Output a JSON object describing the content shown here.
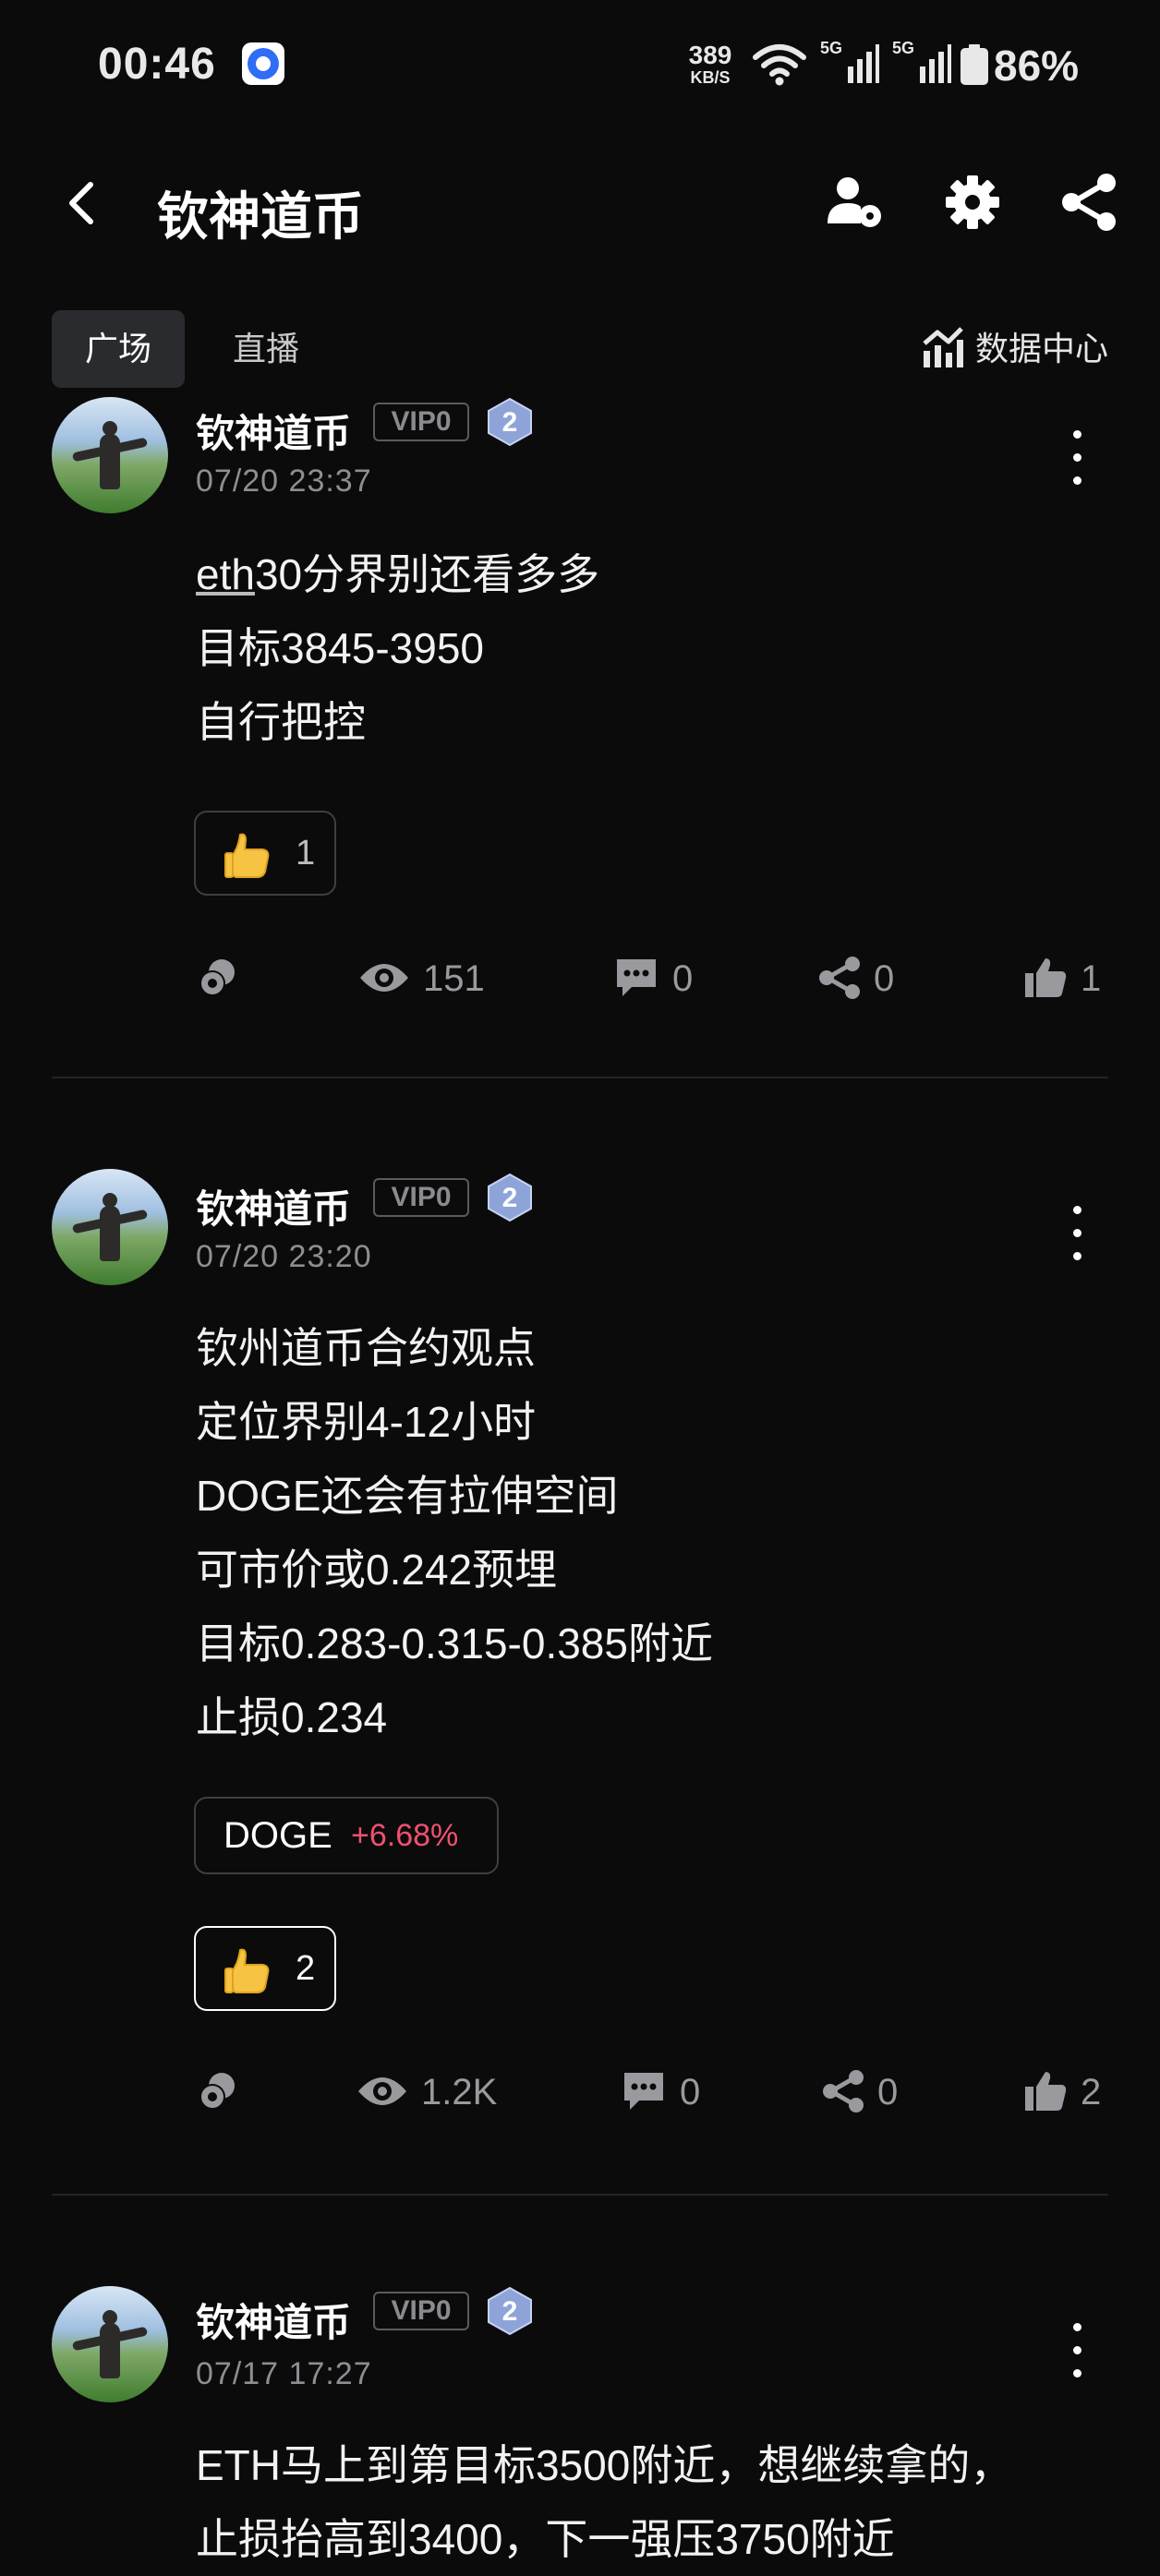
{
  "status_bar": {
    "time": "00:46",
    "net_speed_value": "389",
    "net_speed_unit": "KB/S",
    "signal1_label": "5G",
    "signal2_label": "5G",
    "battery": "86%"
  },
  "header": {
    "title": "钦神道币"
  },
  "tabs": {
    "square": "广场",
    "live": "直播",
    "data_center": "数据中心"
  },
  "posts": [
    {
      "author": "钦神道币",
      "vip": "VIP0",
      "level": "2",
      "time": "07/20 23:37",
      "lines": [
        "eth",
        "30分界别还看多多",
        "目标3845-3950",
        "自行把控"
      ],
      "reaction_count": "1",
      "views": "151",
      "comments": "0",
      "shares": "0",
      "likes": "1"
    },
    {
      "author": "钦神道币",
      "vip": "VIP0",
      "level": "2",
      "time": "07/20 23:20",
      "lines": [
        "钦州道币合约观点",
        "定位界别4-12小时",
        "DOGE还会有拉伸空间",
        "可市价或0.242预埋",
        "目标0.283-0.315-0.385附近",
        "止损0.234"
      ],
      "coin_symbol": "DOGE",
      "coin_change": "+6.68%",
      "reaction_count": "2",
      "views": "1.2K",
      "comments": "0",
      "shares": "0",
      "likes": "2"
    },
    {
      "author": "钦神道币",
      "vip": "VIP0",
      "level": "2",
      "time": "07/17 17:27",
      "lines": [
        "ETH马上到第目标3500附近，想继续拿的，",
        "止损抬高到3400，下一强压3750附近"
      ]
    }
  ],
  "icons": {
    "back": "chevron-left-icon",
    "user": "user-settings-icon",
    "settings": "gear-icon",
    "share": "share-icon",
    "data_center": "chart-icon",
    "reward": "coin-icon",
    "views": "eye-icon",
    "comments": "comment-icon",
    "shares": "share-icon",
    "likes": "thumbs-up-icon",
    "reaction": "thumbs-up-emoji"
  },
  "colors": {
    "background": "#0b0b0c",
    "positive_change": "#f0506e"
  }
}
